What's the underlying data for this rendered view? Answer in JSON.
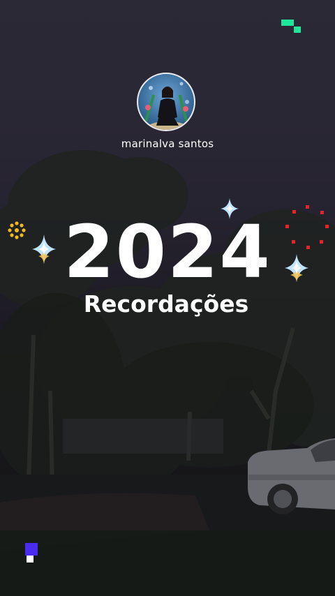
{
  "profile": {
    "name": "marinalva santos"
  },
  "title": {
    "year": "2024",
    "subtitle": "Recordações"
  },
  "icons": {
    "sparkles": [
      "sparkle-icon",
      "sparkle-icon",
      "sparkle-icon"
    ],
    "burst": "firework-icon",
    "flower": "sun-icon",
    "pixels_top": "pixel-blocks-icon",
    "pixels_bottom": "pixel-blocks-icon"
  },
  "colors": {
    "accent_green": "#1ee79a",
    "accent_red": "#e8242a",
    "accent_yellow": "#f2b81c",
    "accent_blue": "#4a2cf0",
    "sparkle_blue": "#bfe4ff",
    "sparkle_gold": "#f2c35a"
  }
}
